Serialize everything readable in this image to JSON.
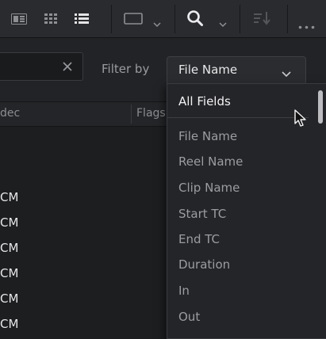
{
  "toolbar": {
    "icons": [
      "list-view-icon",
      "thumbnail-grid-icon",
      "list-icon",
      "clip-view-icon",
      "chevron-down-icon",
      "search-icon",
      "chevron-down-icon",
      "sort-icon",
      "more-options-icon"
    ]
  },
  "search": {
    "placeholder": "",
    "clear_icon": "close-icon"
  },
  "filter": {
    "label": "Filter by",
    "selected": "File Name"
  },
  "table": {
    "columns": [
      "dec",
      "Flags"
    ],
    "rows": [
      "CM",
      "CM",
      "CM",
      "CM",
      "CM",
      "CM"
    ]
  },
  "menu": {
    "selected": "All Fields",
    "options": [
      "File Name",
      "Reel Name",
      "Clip Name",
      "Start TC",
      "End TC",
      "Duration",
      "In",
      "Out"
    ]
  },
  "colors": {
    "background": "#1d1e20",
    "toolbar": "#2a2b2e",
    "menu": "#242528",
    "text": "#e6e6e8",
    "muted": "#9c9da1"
  }
}
